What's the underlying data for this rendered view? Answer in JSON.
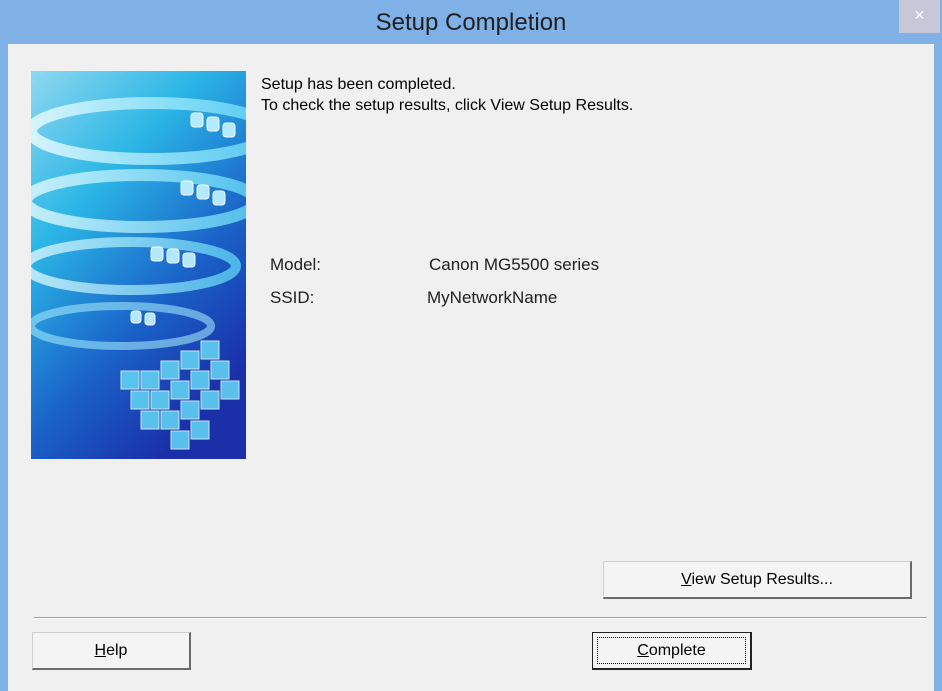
{
  "window": {
    "title": "Setup Completion",
    "close_glyph": "×"
  },
  "message": {
    "line1": "Setup has been completed.",
    "line2": "To check the setup results, click View Setup Results."
  },
  "info": {
    "model_label": "Model:",
    "model_value": "Canon MG5500 series",
    "ssid_label": "SSID:",
    "ssid_value": "MyNetworkName"
  },
  "buttons": {
    "view_results_prefix": "",
    "view_results_mnemonic": "V",
    "view_results_rest": "iew Setup Results...",
    "help_mnemonic": "H",
    "help_rest": "elp",
    "complete_mnemonic": "C",
    "complete_rest": "omplete"
  },
  "icons": {
    "close": "close-icon",
    "side_image": "printer-cubes-illustration"
  },
  "colors": {
    "titlebar": "#7fb0e6",
    "client_bg": "#f0f0f0",
    "close_button": "#c7c7d8"
  }
}
